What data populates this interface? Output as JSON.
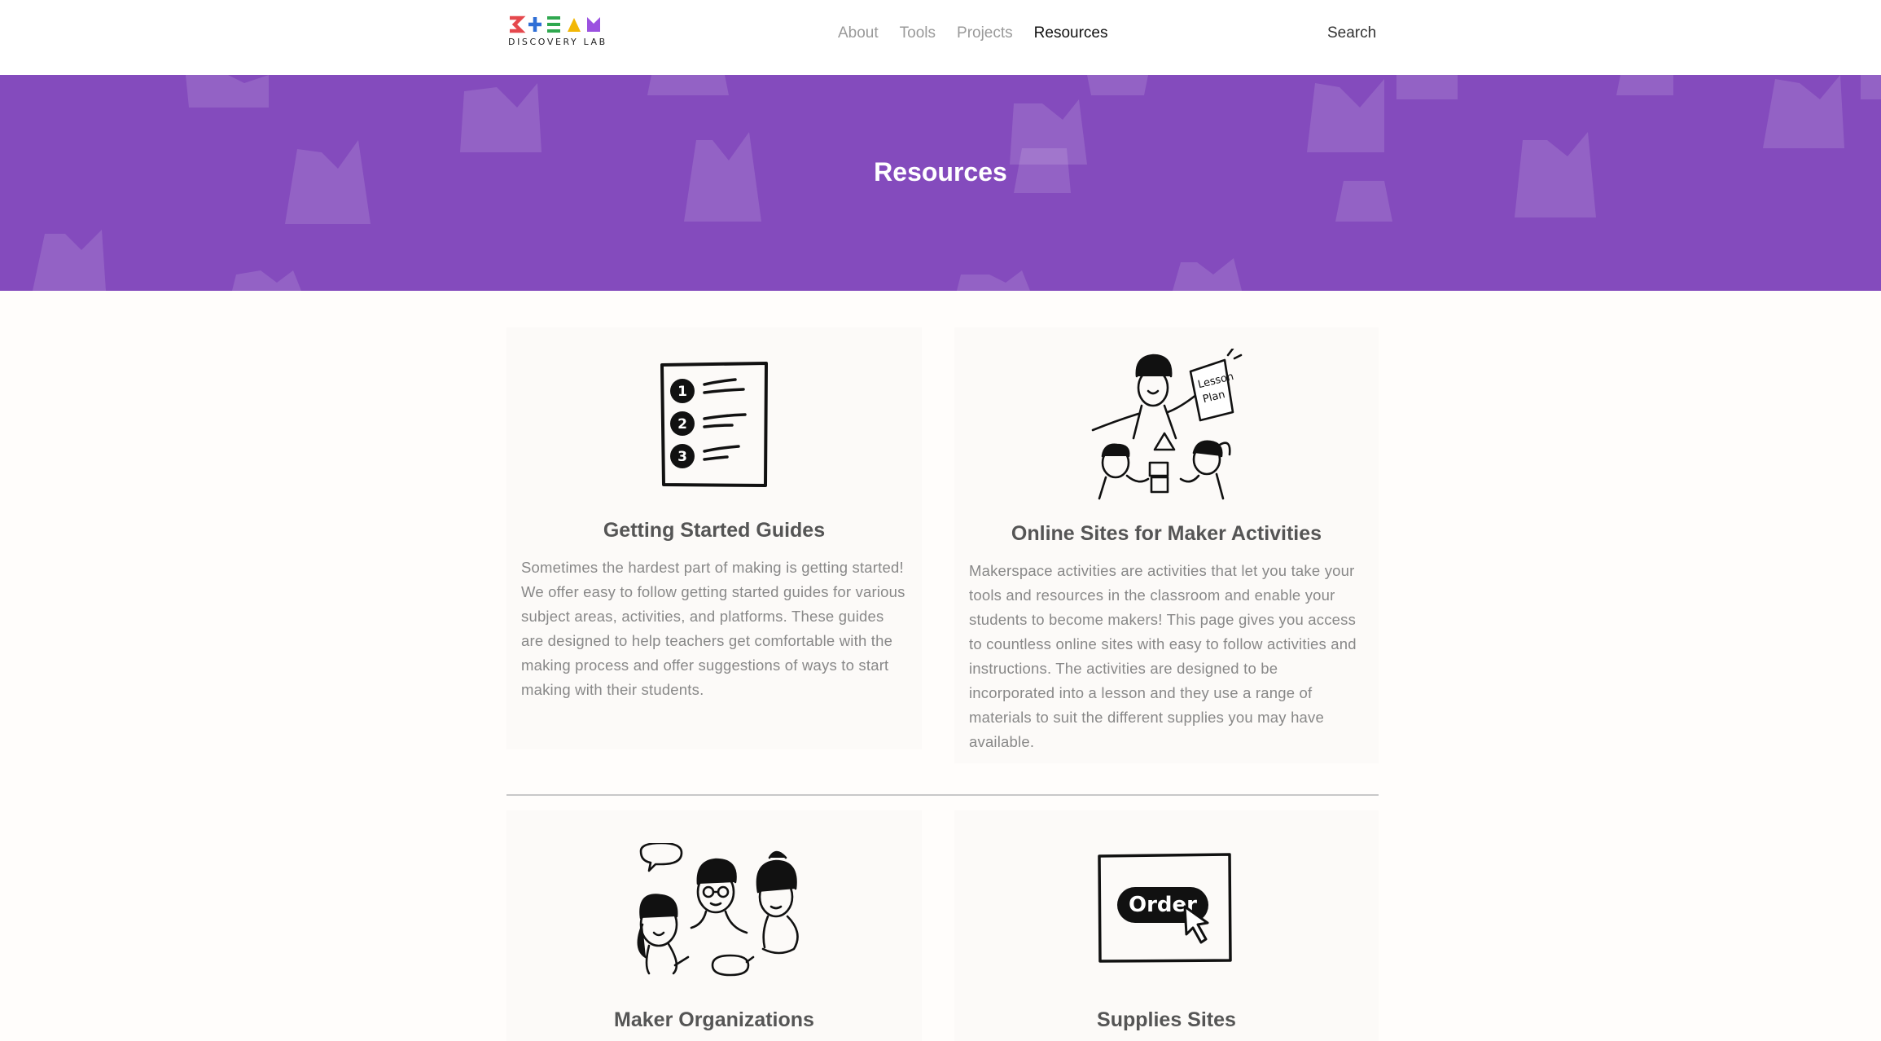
{
  "header": {
    "logo": {
      "text": "DISCOVERY LAB",
      "letters": [
        "S",
        "T",
        "E",
        "A",
        "M"
      ],
      "colors": [
        "#e5484d",
        "#2f6fd6",
        "#2fa84f",
        "#f2b705",
        "#9b51e0"
      ]
    },
    "nav": [
      {
        "label": "About",
        "active": false
      },
      {
        "label": "Tools",
        "active": false
      },
      {
        "label": "Projects",
        "active": false
      },
      {
        "label": "Resources",
        "active": true
      }
    ],
    "search_label": "Search"
  },
  "banner": {
    "title": "Resources",
    "color": "#844bbd"
  },
  "cards": [
    {
      "title": "Getting Started Guides",
      "icon": "numbered-list-icon",
      "text": "Sometimes the hardest part of making is getting started! We offer easy to follow getting started guides for various subject areas, activities, and platforms. These guides are designed to help teachers get comfortable with the making process and offer suggestions of ways to start making with their students."
    },
    {
      "title": "Online Sites for Maker Activities",
      "icon": "teacher-students-icon",
      "illustration_text": [
        "Lesson",
        "Plan"
      ],
      "text": "Makerspace activities are activities that let you take your tools and resources in the classroom and enable your students to become makers! This page gives you access to countless online sites with easy to follow activities and instructions. The activities are designed to be incorporated into a lesson and they use a range of materials to suit the different supplies you may have available."
    },
    {
      "title": "Maker Organizations",
      "icon": "people-talking-icon",
      "text": ""
    },
    {
      "title": "Supplies Sites",
      "icon": "order-button-icon",
      "illustration_text": [
        "Order"
      ],
      "text": ""
    }
  ]
}
